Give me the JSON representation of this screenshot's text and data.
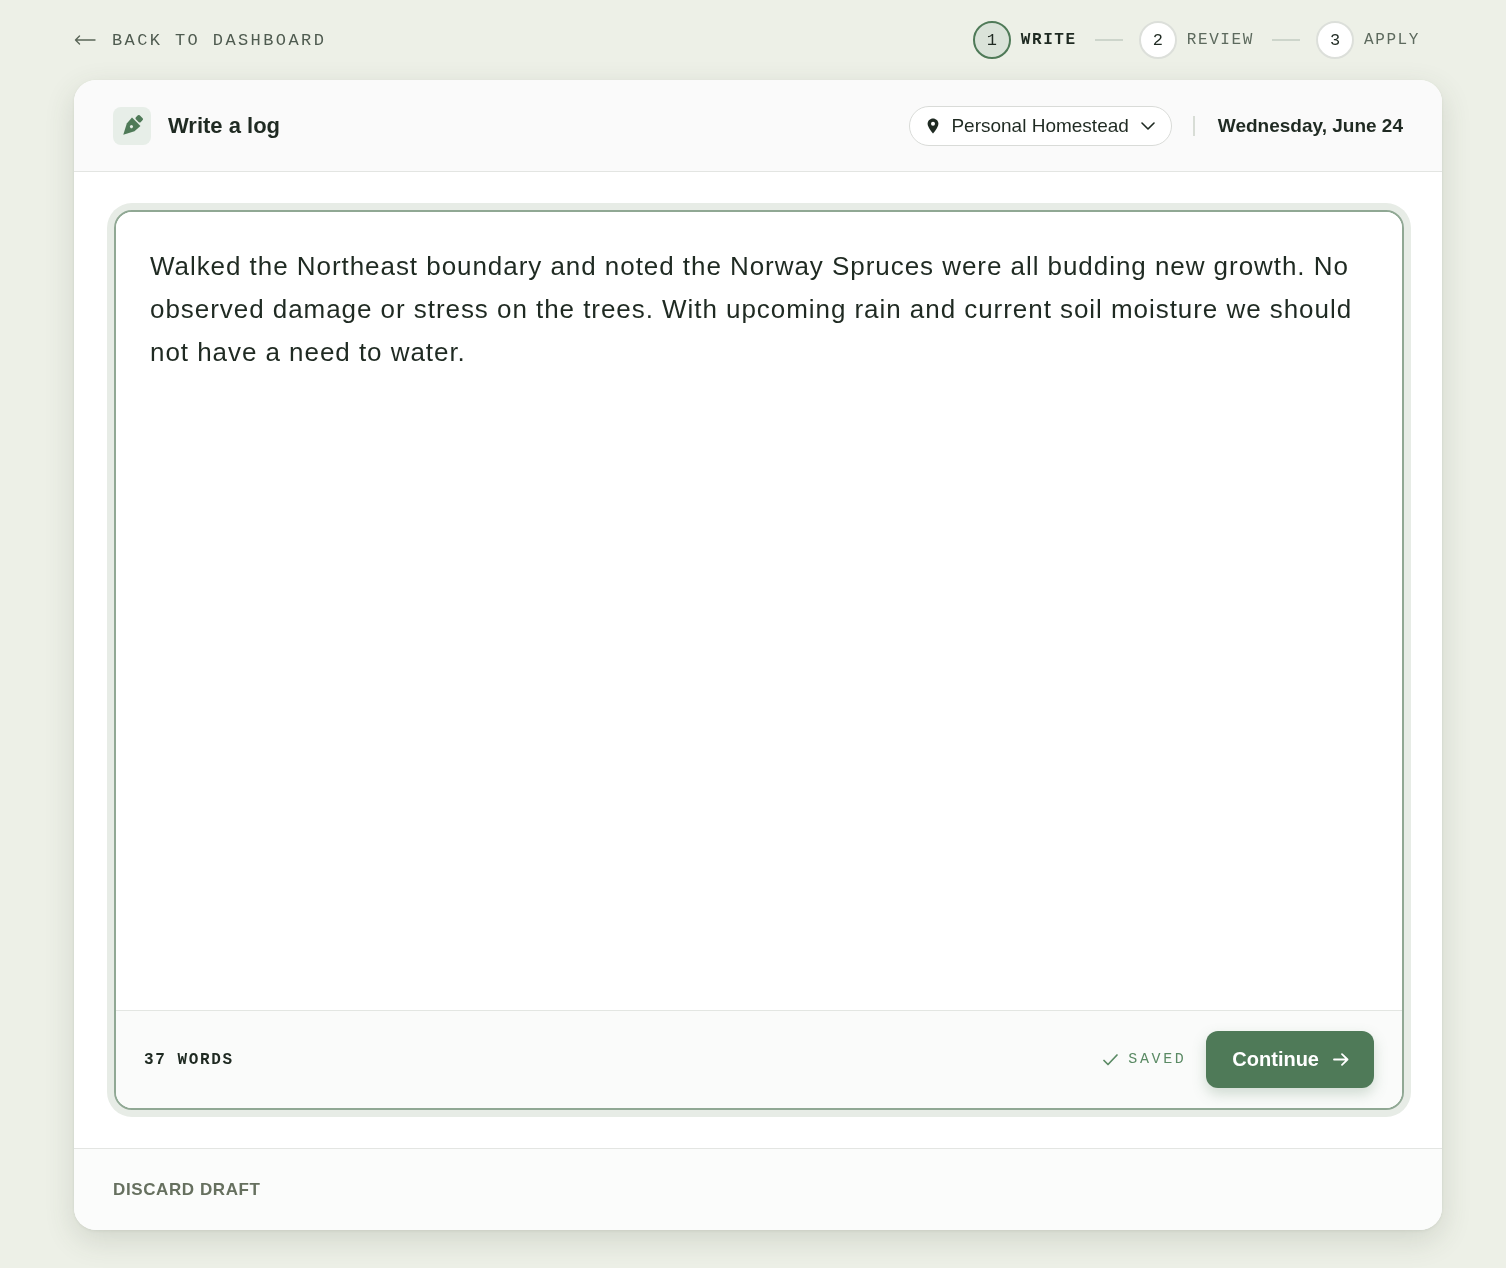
{
  "nav": {
    "back_link": "BACK TO DASHBOARD"
  },
  "steps": [
    {
      "number": "1",
      "label": "WRITE",
      "selected": true
    },
    {
      "number": "2",
      "label": "REVIEW",
      "selected": false
    },
    {
      "number": "3",
      "label": "APPLY",
      "selected": false
    }
  ],
  "header": {
    "title": "Write a log",
    "location": "Personal Homestead",
    "date": "Wednesday, June 24"
  },
  "editor": {
    "value": "Walked the Northeast boundary and noted the Norway Spruces were all budding new growth. No observed damage or stress on the trees. With upcoming rain and current soil moisture we should not have a need to water.",
    "word_count": "37 WORDS",
    "status": "SAVED",
    "continue_button": "Continue"
  },
  "footer": {
    "discard_button": "DISCARD DRAFT"
  }
}
